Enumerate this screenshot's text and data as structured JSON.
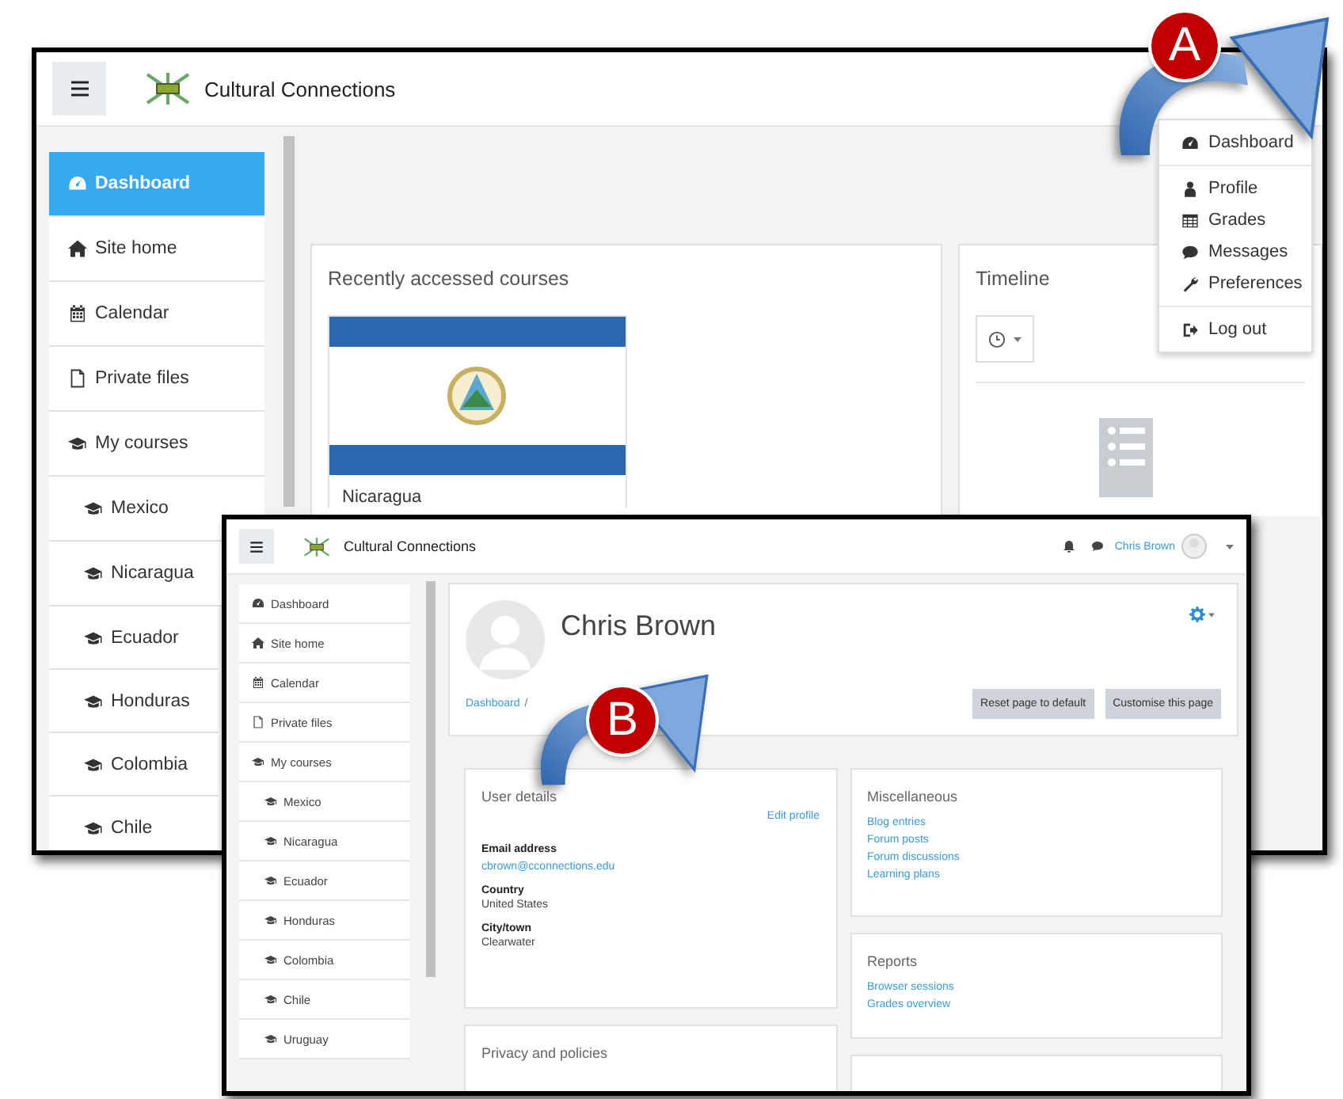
{
  "dashboard_window": {
    "site_name": "Cultural Connections",
    "sidebar": {
      "items": [
        {
          "label": "Dashboard",
          "selected": true
        },
        {
          "label": "Site home",
          "selected": false
        },
        {
          "label": "Calendar",
          "selected": false
        },
        {
          "label": "Private files",
          "selected": false
        },
        {
          "label": "My courses",
          "selected": false,
          "children": [
            {
              "label": "Mexico",
              "selected": false
            },
            {
              "label": "Nicaragua",
              "selected": false
            },
            {
              "label": "Ecuador",
              "selected": false
            },
            {
              "label": "Honduras",
              "selected": false
            },
            {
              "label": "Colombia",
              "selected": false
            },
            {
              "label": "Chile",
              "selected": false
            }
          ]
        }
      ]
    },
    "recent_courses": {
      "title": "Recently accessed courses",
      "courses": [
        {
          "name": "Nicaragua"
        }
      ]
    },
    "timeline": {
      "title": "Timeline"
    },
    "user_menu": {
      "groups": [
        {
          "items": [
            "Dashboard"
          ]
        },
        {
          "items": [
            "Profile",
            "Grades",
            "Messages",
            "Preferences"
          ]
        },
        {
          "items": [
            "Log out"
          ]
        }
      ]
    }
  },
  "profile_window": {
    "site_name": "Cultural Connections",
    "user_name": "Chris Brown",
    "sidebar": {
      "items": [
        {
          "label": "Dashboard",
          "selected": false
        },
        {
          "label": "Site home",
          "selected": false
        },
        {
          "label": "Calendar",
          "selected": false
        },
        {
          "label": "Private files",
          "selected": false
        },
        {
          "label": "My courses",
          "selected": false,
          "children": [
            {
              "label": "Mexico",
              "selected": false
            },
            {
              "label": "Nicaragua",
              "selected": false
            },
            {
              "label": "Ecuador",
              "selected": false
            },
            {
              "label": "Honduras",
              "selected": false
            },
            {
              "label": "Colombia",
              "selected": false
            },
            {
              "label": "Chile",
              "selected": false
            },
            {
              "label": "Uruguay",
              "selected": false
            }
          ]
        }
      ]
    },
    "profile": {
      "name": "Chris Brown",
      "breadcrumb": [
        "Dashboard",
        "/"
      ],
      "buttons": [
        "Reset page to default",
        "Customise this page"
      ]
    },
    "user_details": {
      "title": "User details",
      "edit_link": "Edit profile",
      "fields": [
        {
          "label": "Email address",
          "value": "cbrown@cconnections.edu",
          "kind": "link"
        },
        {
          "label": "Country",
          "value": "United States",
          "kind": "text"
        },
        {
          "label": "City/town",
          "value": "Clearwater",
          "kind": "text"
        }
      ]
    },
    "privacy": {
      "title": "Privacy and policies"
    },
    "miscellaneous": {
      "title": "Miscellaneous",
      "links": [
        "Blog entries",
        "Forum posts",
        "Forum discussions",
        "Learning plans"
      ]
    },
    "reports": {
      "title": "Reports",
      "links": [
        "Browser sessions",
        "Grades overview"
      ]
    }
  },
  "callouts": [
    {
      "label": "A"
    },
    {
      "label": "B"
    }
  ]
}
